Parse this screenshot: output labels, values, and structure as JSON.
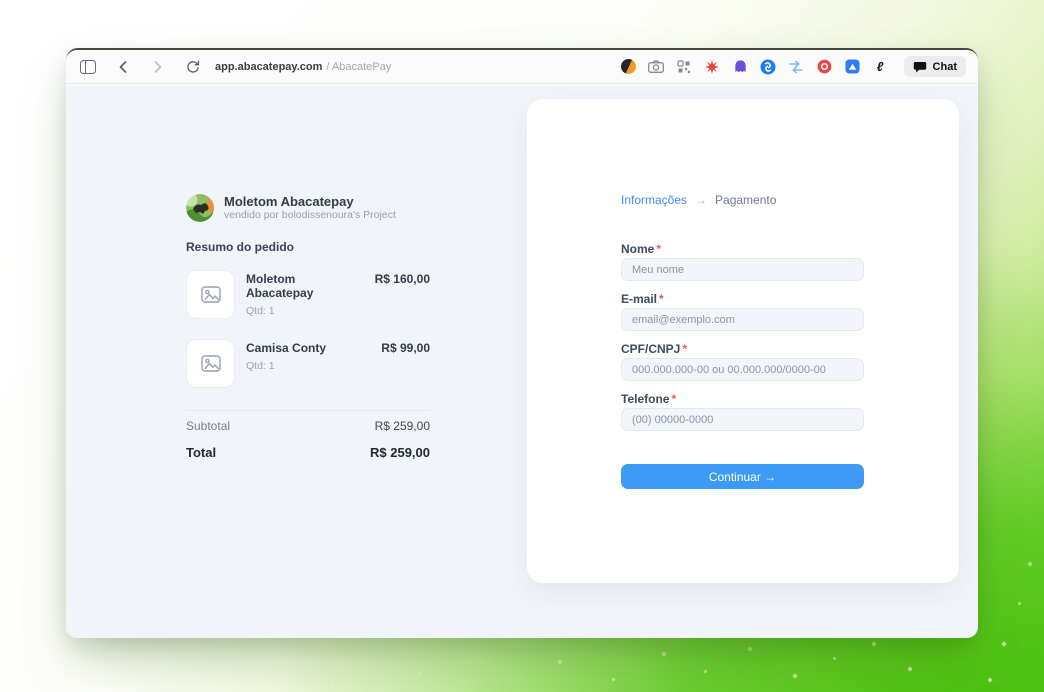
{
  "browser": {
    "url_host": "app.abacatepay.com",
    "url_suffix": "/ AbacatePay",
    "chat_label": "Chat",
    "nav_icons": [
      "sidebar-icon",
      "back-icon",
      "forward-icon",
      "reload-icon"
    ],
    "extension_icons": [
      "orange-circle-extension-icon",
      "camera-extension-icon",
      "qr-scan-extension-icon",
      "red-starburst-extension-icon",
      "purple-ghost-extension-icon",
      "shazam-extension-icon",
      "blue-arrows-extension-icon",
      "red-badge-extension-icon",
      "blue-mountain-extension-icon",
      "cursive-letter-extension-icon"
    ]
  },
  "merchant": {
    "name": "Moletom Abacatepay",
    "seller": "vendido por bolodissenoura's Project"
  },
  "order": {
    "title": "Resumo do pedido",
    "items": [
      {
        "name": "Moletom Abacatepay",
        "qty": "Qtd: 1",
        "price": "R$ 160,00"
      },
      {
        "name": "Camisa Conty",
        "qty": "Qtd: 1",
        "price": "R$ 99,00"
      }
    ],
    "subtotal_label": "Subtotal",
    "subtotal_value": "R$ 259,00",
    "total_label": "Total",
    "total_value": "R$ 259,00"
  },
  "checkout": {
    "steps": {
      "current": "Informações",
      "separator": "→",
      "next": "Pagamento"
    },
    "required_mark": "*",
    "fields": [
      {
        "label": "Nome",
        "placeholder": "Meu nome"
      },
      {
        "label": "E-mail",
        "placeholder": "email@exemplo.com"
      },
      {
        "label": "CPF/CNPJ",
        "placeholder": "000.000.000-00 ou 00.000.000/0000-00"
      },
      {
        "label": "Telefone",
        "placeholder": "(00) 00000-0000"
      }
    ],
    "submit_label": "Continuar →"
  },
  "colors": {
    "accent_blue": "#3d9bf5",
    "link_blue": "#3e8ef7",
    "required_red": "#f2594b",
    "page_bg": "#f1f4f8",
    "background_green": "#52c31c"
  }
}
